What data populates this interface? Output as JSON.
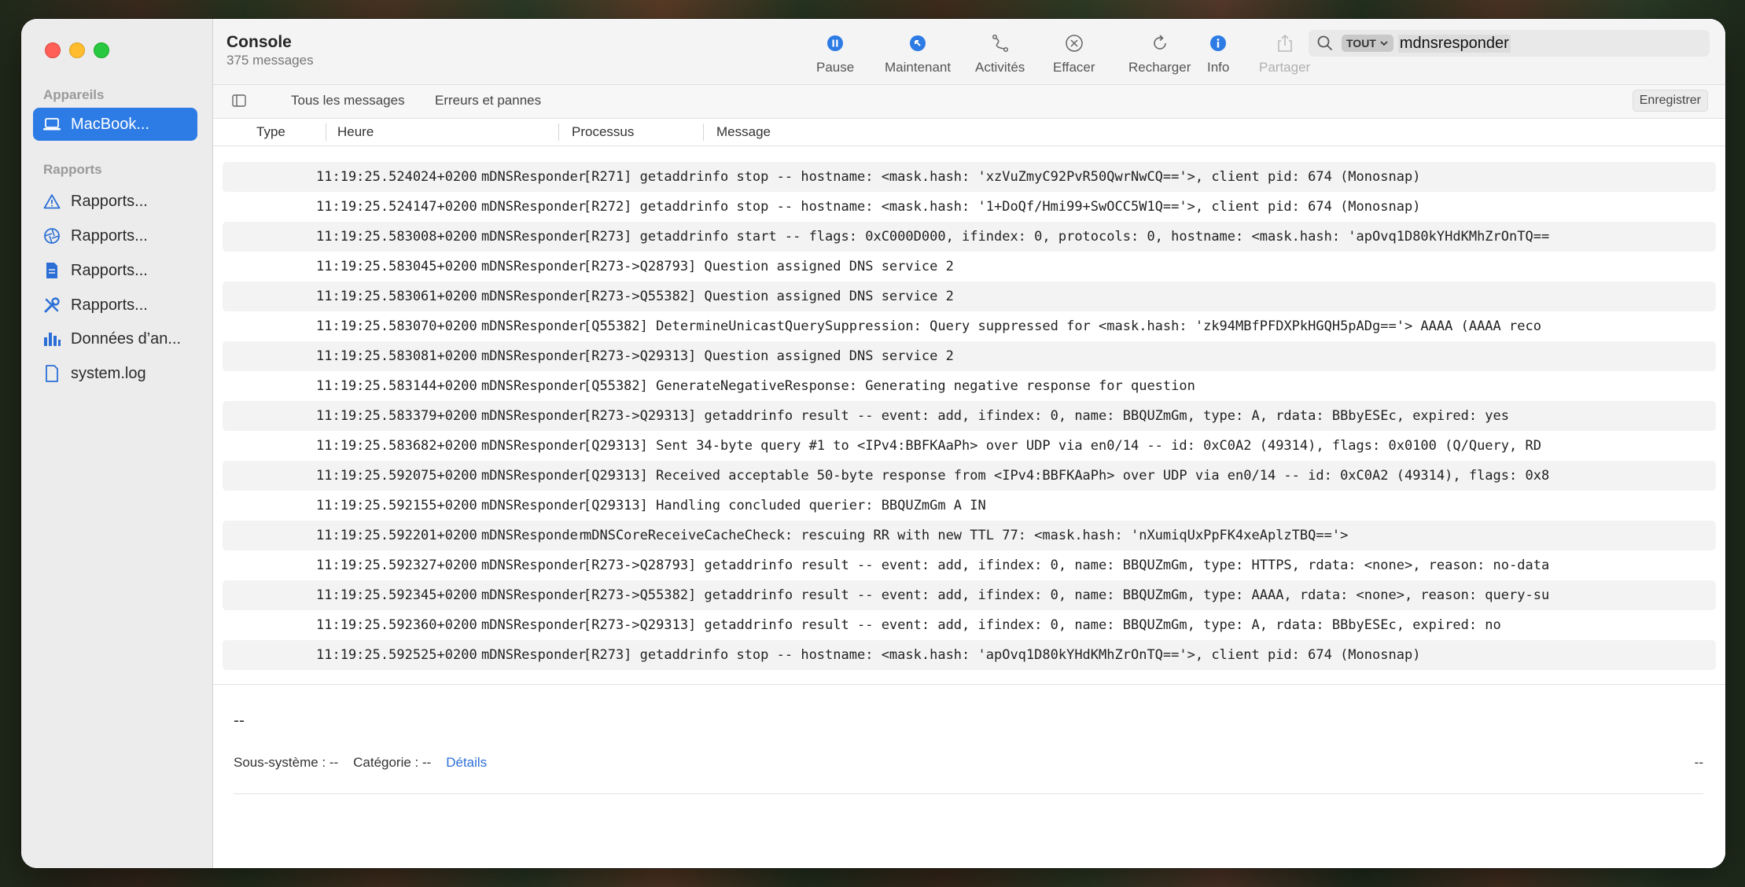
{
  "sidebar": {
    "sections": [
      {
        "heading": "Appareils",
        "items": [
          {
            "label": "MacBook...",
            "icon": "laptop-icon",
            "selected": true
          }
        ]
      },
      {
        "heading": "Rapports",
        "items": [
          {
            "label": "Rapports...",
            "icon": "warning-icon"
          },
          {
            "label": "Rapports...",
            "icon": "aperture-icon"
          },
          {
            "label": "Rapports...",
            "icon": "document-icon"
          },
          {
            "label": "Rapports...",
            "icon": "tools-icon"
          },
          {
            "label": "Données d’an...",
            "icon": "bar-chart-icon"
          },
          {
            "label": "system.log",
            "icon": "file-icon"
          }
        ]
      }
    ]
  },
  "toolbar": {
    "title": "Console",
    "subtitle": "375 messages",
    "pause": "Pause",
    "now": "Maintenant",
    "activities": "Activités",
    "clear": "Effacer",
    "reload": "Recharger",
    "info": "Info",
    "share": "Partager"
  },
  "search": {
    "scope": "TOUT",
    "value": "mdnsresponder"
  },
  "filters": {
    "all": "Tous les messages",
    "errors": "Erreurs et pannes",
    "save": "Enregistrer"
  },
  "columns": {
    "type": "Type",
    "time": "Heure",
    "process": "Processus",
    "message": "Message"
  },
  "rows": [
    {
      "time": "11:19:25.524024+0200",
      "process": "mDNSResponder",
      "message": "[R271] getaddrinfo stop -- hostname: <mask.hash: 'xzVuZmyC92PvR50QwrNwCQ=='>, client pid: 674 (Monosnap)"
    },
    {
      "time": "11:19:25.524147+0200",
      "process": "mDNSResponder",
      "message": "[R272] getaddrinfo stop -- hostname: <mask.hash: '1+DoQf/Hmi99+SwOCC5W1Q=='>, client pid: 674 (Monosnap)"
    },
    {
      "time": "11:19:25.583008+0200",
      "process": "mDNSResponder",
      "message": "[R273] getaddrinfo start -- flags: 0xC000D000, ifindex: 0, protocols: 0, hostname: <mask.hash: 'apOvq1D80kYHdKMhZrOnTQ=="
    },
    {
      "time": "11:19:25.583045+0200",
      "process": "mDNSResponder",
      "message": "[R273->Q28793] Question assigned DNS service 2"
    },
    {
      "time": "11:19:25.583061+0200",
      "process": "mDNSResponder",
      "message": "[R273->Q55382] Question assigned DNS service 2"
    },
    {
      "time": "11:19:25.583070+0200",
      "process": "mDNSResponder",
      "message": "[Q55382] DetermineUnicastQuerySuppression: Query suppressed for <mask.hash: 'zk94MBfPFDXPkHGQH5pADg=='> AAAA (AAAA reco"
    },
    {
      "time": "11:19:25.583081+0200",
      "process": "mDNSResponder",
      "message": "[R273->Q29313] Question assigned DNS service 2"
    },
    {
      "time": "11:19:25.583144+0200",
      "process": "mDNSResponder",
      "message": "[Q55382] GenerateNegativeResponse: Generating negative response for question"
    },
    {
      "time": "11:19:25.583379+0200",
      "process": "mDNSResponder",
      "message": "[R273->Q29313] getaddrinfo result -- event: add, ifindex: 0, name: BBQUZmGm, type: A, rdata: BBbyESEc, expired: yes"
    },
    {
      "time": "11:19:25.583682+0200",
      "process": "mDNSResponder",
      "message": "[Q29313] Sent 34-byte query #1 to <IPv4:BBFKAaPh> over UDP via en0/14 -- id: 0xC0A2 (49314), flags: 0x0100 (Q/Query, RD"
    },
    {
      "time": "11:19:25.592075+0200",
      "process": "mDNSResponder",
      "message": "[Q29313] Received acceptable 50-byte response from <IPv4:BBFKAaPh> over UDP via en0/14 -- id: 0xC0A2 (49314), flags: 0x8"
    },
    {
      "time": "11:19:25.592155+0200",
      "process": "mDNSResponder",
      "message": "[Q29313] Handling concluded querier: BBQUZmGm A IN"
    },
    {
      "time": "11:19:25.592201+0200",
      "process": "mDNSResponder",
      "message": "mDNSCoreReceiveCacheCheck: rescuing RR with new TTL 77: <mask.hash: 'nXumiqUxPpFK4xeAplzTBQ=='>"
    },
    {
      "time": "11:19:25.592327+0200",
      "process": "mDNSResponder",
      "message": "[R273->Q28793] getaddrinfo result -- event: add, ifindex: 0, name: BBQUZmGm, type: HTTPS, rdata: <none>, reason: no-data"
    },
    {
      "time": "11:19:25.592345+0200",
      "process": "mDNSResponder",
      "message": "[R273->Q55382] getaddrinfo result -- event: add, ifindex: 0, name: BBQUZmGm, type: AAAA, rdata: <none>, reason: query-su"
    },
    {
      "time": "11:19:25.592360+0200",
      "process": "mDNSResponder",
      "message": "[R273->Q29313] getaddrinfo result -- event: add, ifindex: 0, name: BBQUZmGm, type: A, rdata: BBbyESEc, expired: no"
    },
    {
      "time": "11:19:25.592525+0200",
      "process": "mDNSResponder",
      "message": "[R273] getaddrinfo stop -- hostname: <mask.hash: 'apOvq1D80kYHdKMhZrOnTQ=='>, client pid: 674 (Monosnap)"
    }
  ],
  "detail": {
    "title": "--",
    "subsystem_label": "Sous-système : --",
    "category_label": "Catégorie : --",
    "details_link": "Détails",
    "right_value": "--"
  },
  "colors": {
    "accent": "#2d7be5",
    "link": "#2b6fd6"
  }
}
